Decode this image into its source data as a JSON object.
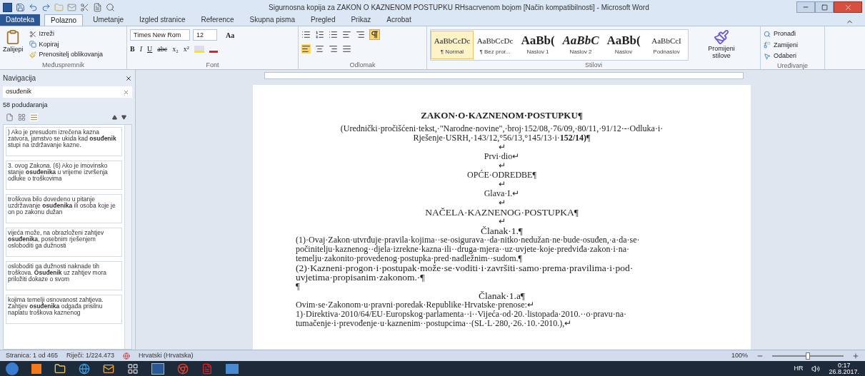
{
  "window": {
    "title": "Sigurnosna kopija za ZAKON O KAZNENOM POSTUPKU RHsacrvenom bojom [Način kompatibilnosti]  -  Microsoft Word"
  },
  "tabs": [
    {
      "label": "Datoteka",
      "kind": "file",
      "selected": false
    },
    {
      "label": "Polazno",
      "kind": "tab",
      "selected": true
    },
    {
      "label": "Umetanje",
      "kind": "tab",
      "selected": false
    },
    {
      "label": "Izgled stranice",
      "kind": "tab",
      "selected": false
    },
    {
      "label": "Reference",
      "kind": "tab",
      "selected": false
    },
    {
      "label": "Skupna pisma",
      "kind": "tab",
      "selected": false
    },
    {
      "label": "Pregled",
      "kind": "tab",
      "selected": false
    },
    {
      "label": "Prikaz",
      "kind": "tab",
      "selected": false
    },
    {
      "label": "Acrobat",
      "kind": "tab",
      "selected": false
    }
  ],
  "ribbon": {
    "clipboard": {
      "paste": "Zalijepi",
      "cut": "Izreži",
      "copy": "Kopiraj",
      "format_painter": "Prenositelj oblikovanja",
      "group": "Međuspremnik"
    },
    "font": {
      "name": "Times New Rom",
      "size": "12",
      "case": "Aa",
      "format_buttons": [
        "B",
        "I",
        "U",
        "abc",
        "x₂",
        "x²"
      ],
      "group": "Font"
    },
    "paragraph": {
      "group": "Odlomak",
      "show_marks": true
    },
    "styles": {
      "items": [
        {
          "preview": "AaBbCcDc",
          "name": "¶ Normal",
          "kind": "normal",
          "selected": true
        },
        {
          "preview": "AaBbCcDc",
          "name": "¶ Bez pror...",
          "kind": "normal",
          "selected": false
        },
        {
          "preview": "AaBb(",
          "name": "Naslov 1",
          "kind": "heading",
          "selected": false
        },
        {
          "preview": "AaBbC",
          "name": "Naslov 2",
          "kind": "italic",
          "selected": false
        },
        {
          "preview": "AaBb(",
          "name": "Naslov",
          "kind": "heading",
          "selected": false
        },
        {
          "preview": "AaBbCcI",
          "name": "Podnaslov",
          "kind": "normal",
          "selected": false
        }
      ],
      "change": "Promijeni stilove",
      "group": "Stilovi"
    },
    "editing": {
      "find": "Pronađi",
      "replace": "Zamijeni",
      "select": "Odaberi",
      "group": "Uređivanje"
    }
  },
  "navigation": {
    "title": "Navigacija",
    "search": "osuđenik",
    "count": "58 podudaranja",
    "results": [
      ") Ako je presudom izrečena kazna zatvora, jamstvo se ukida kad **osuđenik** stupi na izdržavanje kazne.",
      "3. ovog Zakona. (6) Ako je imovinsko stanje **osuđenika** u vrijeme izvršenja odluke o troškovima",
      "troškova bilo dovedeno u pitanje uzdržavanje **osuđenika** ili osoba koje je on po zakonu dužan",
      "vijeća može, na obrazloženi zahtjev **osuđenika**, posebnim rješenjem osloboditi ga dužnosti",
      "osloboditi ga dužnosti naknade tih troškova. **Osuđenik** uz zahtjev mora priložiti dokaze o svom",
      "kojima temelji osnovanost zahtjeva. Zahtjev **osuđenika** odgađa prisilnu naplatu troškova kaznenog"
    ]
  },
  "document": {
    "lines": [
      {
        "kind": "title",
        "text": "ZAKON·O·KAZNENOM·POSTUPKU¶"
      },
      {
        "kind": "center",
        "text": "(Urednički·pročišćeni·tekst,·\"Narodne·novine\",·broj·152/08,·76/09,·80/11,·91/12·-·Odluka·i·"
      },
      {
        "kind": "center",
        "text": "Rješenje·USRH,·143/12,°56/13,°145/13·i·**152/14)**¶"
      },
      {
        "kind": "center",
        "text": "↵"
      },
      {
        "kind": "center",
        "text": "Prvi·dio↵"
      },
      {
        "kind": "center",
        "text": "↵"
      },
      {
        "kind": "center",
        "text": "OPĆE·ODREDBE¶"
      },
      {
        "kind": "center",
        "text": "↵"
      },
      {
        "kind": "center",
        "text": "Glava·I.↵"
      },
      {
        "kind": "center",
        "text": "↵"
      },
      {
        "kind": "center-large",
        "text": "NAČELA·KAZNENOG·POSTUPKA¶"
      },
      {
        "kind": "center",
        "text": "↵"
      },
      {
        "kind": "center-large",
        "text": "Članak·1.¶"
      },
      {
        "kind": "body",
        "text": "(1)·Ovaj·Zakon·utvrđuje·pravila·kojima··se·osigurava··da·nitko·nedužan·ne·bude·osuđen,·a·da·se·"
      },
      {
        "kind": "body",
        "text": "počinitelju·kaznenog··djela·izrekne·kazna·ili··druga·mjera··uz·uvjete·koje·predviđa·zakon·i·na·"
      },
      {
        "kind": "body",
        "text": "temelju·zakonito·provedenog·postupka·pred·nadležnim··sudom.¶"
      },
      {
        "kind": "body-large",
        "text": "(2)·Kazneni·progon·i·postupak·može·se·voditi·i·završiti·samo·prema·pravilima·i·pod·"
      },
      {
        "kind": "body-large",
        "text": "uvjetima·propisanim·zakonom.·¶"
      },
      {
        "kind": "body",
        "text": "¶"
      },
      {
        "kind": "center-large",
        "text": "Članak·1.a¶"
      },
      {
        "kind": "body",
        "text": "Ovim·se·Zakonom·u·pravni·poredak·Republike·Hrvatske·prenose:↵"
      },
      {
        "kind": "body",
        "text": "1)·Direktiva·2010/64/EU·Europskog·parlamenta··i··Vijeća·od·20.·listopada·2010.··o·pravu·na·"
      },
      {
        "kind": "body",
        "text": "tumačenje·i·prevođenje·u·kaznenim··postupcima··(SL·L·280,·26.·10.·2010.),↵"
      }
    ]
  },
  "status_bar": {
    "page": "Stranica: 1 od 465",
    "words": "Riječi: 1/224.473",
    "language": "Hrvatski (Hrvatska)",
    "zoom": "100%",
    "zoom_slider": {
      "level": 0.5
    }
  },
  "taskbar": {
    "language": "HR",
    "time": "0:17",
    "date": "26.8.2017."
  }
}
